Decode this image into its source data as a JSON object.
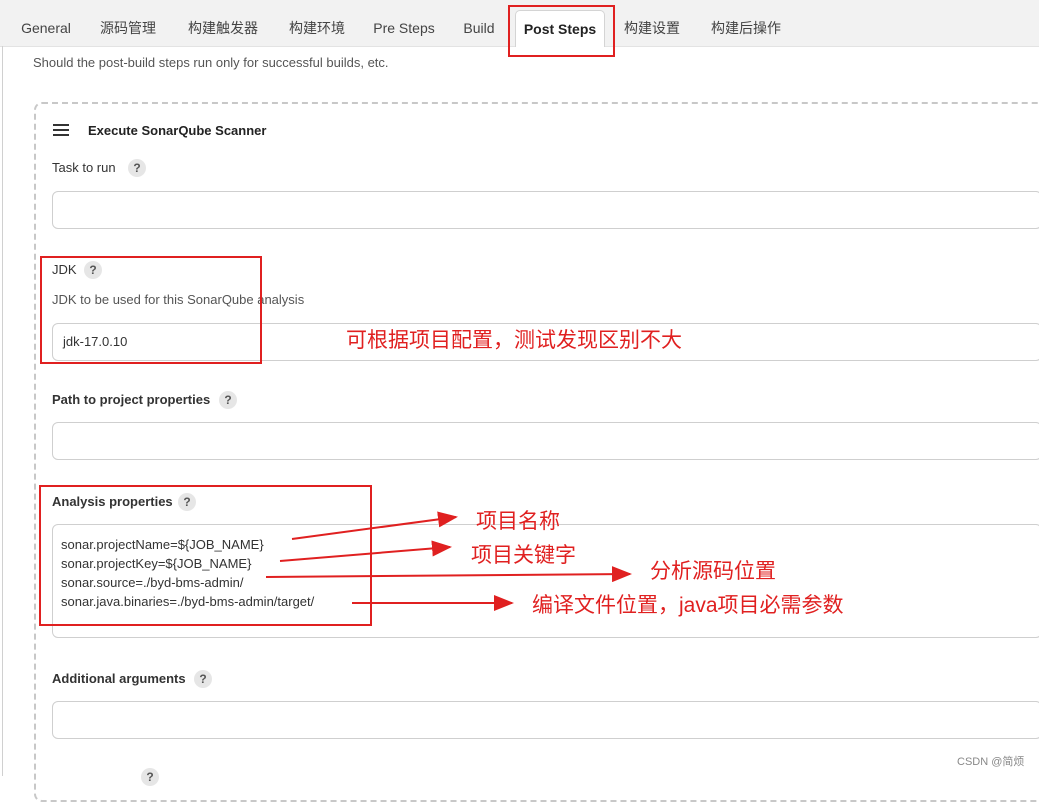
{
  "tabs": [
    {
      "label": "General",
      "active": false
    },
    {
      "label": "源码管理",
      "active": false
    },
    {
      "label": "构建触发器",
      "active": false
    },
    {
      "label": "构建环境",
      "active": false
    },
    {
      "label": "Pre Steps",
      "active": false
    },
    {
      "label": "Build",
      "active": false
    },
    {
      "label": "Post Steps",
      "active": true
    },
    {
      "label": "构建设置",
      "active": false
    },
    {
      "label": "构建后操作",
      "active": false
    }
  ],
  "post_steps": {
    "description": "Should the post-build steps run only for successful builds, etc."
  },
  "step": {
    "drag_icon": "hamburger-icon",
    "title": "Execute SonarQube Scanner",
    "task_to_run": {
      "label": "Task to run",
      "value": ""
    },
    "jdk": {
      "label": "JDK",
      "description": "JDK to be used for this SonarQube analysis",
      "value": "jdk-17.0.10"
    },
    "project_properties_path": {
      "label": "Path to project properties",
      "value": ""
    },
    "analysis_properties": {
      "label": "Analysis properties",
      "lines": [
        "sonar.projectName=${JOB_NAME}",
        "sonar.projectKey=${JOB_NAME}",
        "sonar.source=./byd-bms-admin/",
        "sonar.java.binaries=./byd-bms-admin/target/"
      ]
    },
    "additional_arguments": {
      "label": "Additional arguments",
      "value": ""
    },
    "help_glyph": "?"
  },
  "annotations": {
    "jdk_note": "可根据项目配置，测试发现区别不大",
    "project_name_note": "项目名称",
    "project_key_note": "项目关键字",
    "source_note": "分析源码位置",
    "binaries_note": "编译文件位置，java项目必需参数",
    "color": "#e02020"
  },
  "watermark": "CSDN @简烦"
}
